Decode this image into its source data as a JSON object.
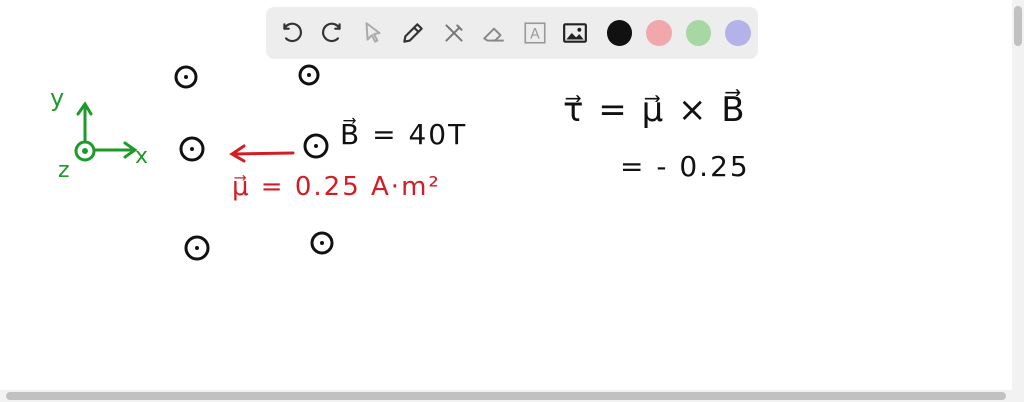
{
  "toolbar": {
    "tools": [
      {
        "icon": "undo-icon"
      },
      {
        "icon": "redo-icon"
      },
      {
        "icon": "pointer-icon"
      },
      {
        "icon": "pen-icon"
      },
      {
        "icon": "tools-icon"
      },
      {
        "icon": "eraser-icon"
      },
      {
        "icon": "text-icon",
        "label": "A"
      },
      {
        "icon": "image-icon"
      }
    ],
    "colors": [
      "#111111",
      "#f0a8ad",
      "#a7d8a4",
      "#b3b3ea"
    ]
  },
  "notes": {
    "axis_y": "y",
    "axis_x": "x",
    "axis_z": "z",
    "field_eq": "B⃗ = 40T",
    "moment_eq": "μ⃗ = 0.25 A·m²",
    "torque_eq": "τ⃗ = μ⃗ × B⃗",
    "result_eq": "=  - 0.25"
  }
}
